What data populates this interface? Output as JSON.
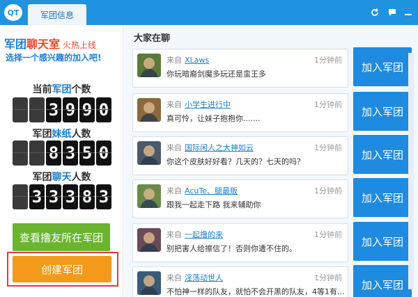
{
  "titlebar": {
    "logo_text": "QT",
    "tab_label": "军团信息",
    "icons": [
      "refresh-icon",
      "chat-icon",
      "minimize-icon"
    ]
  },
  "promo": {
    "line1_a": "军团",
    "line1_b": "聊天室",
    "line1_sub": "火热上线",
    "line2": "选择一个感兴趣的加入吧!"
  },
  "stats": [
    {
      "label_a": "当前",
      "label_hl": "军团",
      "label_b": "个数",
      "digits": [
        "",
        "",
        "3",
        "9",
        "9",
        "0"
      ]
    },
    {
      "label_a": "军团",
      "label_hl": "妹纸",
      "label_b": "人数",
      "digits": [
        "",
        "",
        "8",
        "3",
        "5",
        "0"
      ]
    },
    {
      "label_a": "军团",
      "label_hl": "聊天",
      "label_b": "人数",
      "digits": [
        "",
        "3",
        "3",
        "3",
        "8",
        "3"
      ]
    }
  ],
  "buttons": {
    "view_label": "查看撸友所在军团",
    "create_label": "创建军团"
  },
  "chat": {
    "title": "大家在聊",
    "from_label": "来自",
    "join_label": "加入军团",
    "items": [
      {
        "user": "XLaws",
        "time": "1分钟前",
        "message": "你玩暗裔剑魔多玩还是蛮王多",
        "avatar_color": "#5a7a3a"
      },
      {
        "user": "小学生进行中",
        "time": "1分钟前",
        "message": "真可怜，让妹子抱抱你.......",
        "avatar_color": "#8a6a3a"
      },
      {
        "user": "国际闲人之大神如云",
        "time": "1分钟前",
        "message": "你这个皮肤好好看？几天的？七天的吗？",
        "avatar_color": "#4a5a6a"
      },
      {
        "user": "AcuTe、腿最贩",
        "time": "1分钟前",
        "message": "跟我一起走下路 我来辅助你",
        "avatar_color": "#6a8a4a"
      },
      {
        "user": "一起撸的来",
        "time": "1分钟前",
        "message": "别把害人给擦信了！否则你遭不住的。",
        "avatar_color": "#6a4a5a"
      },
      {
        "user": "淫荡动世人",
        "time": "1分钟前",
        "message": "不怕神一样的队友，就怕不会开黑的队友，4等1有...",
        "avatar_color": "#3a5a7a"
      }
    ]
  }
}
